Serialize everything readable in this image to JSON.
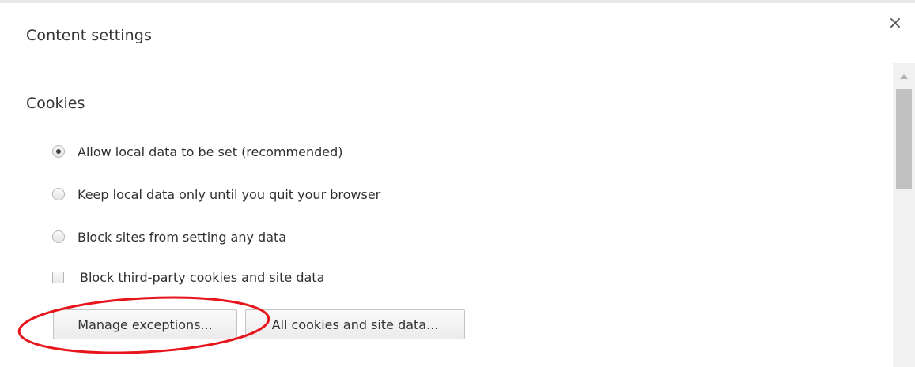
{
  "dialog": {
    "title": "Content settings",
    "close_glyph": "×"
  },
  "cookies": {
    "section_title": "Cookies",
    "options": [
      {
        "label": "Allow local data to be set (recommended)",
        "selected": true
      },
      {
        "label": "Keep local data only until you quit your browser",
        "selected": false
      },
      {
        "label": "Block sites from setting any data",
        "selected": false
      }
    ],
    "block_third_party": {
      "label": "Block third-party cookies and site data",
      "checked": false
    },
    "buttons": {
      "manage_exceptions": "Manage exceptions...",
      "all_cookies": "All cookies and site data..."
    }
  },
  "annotation": {
    "color": "#e8141b",
    "target": "manage-exceptions-button"
  }
}
